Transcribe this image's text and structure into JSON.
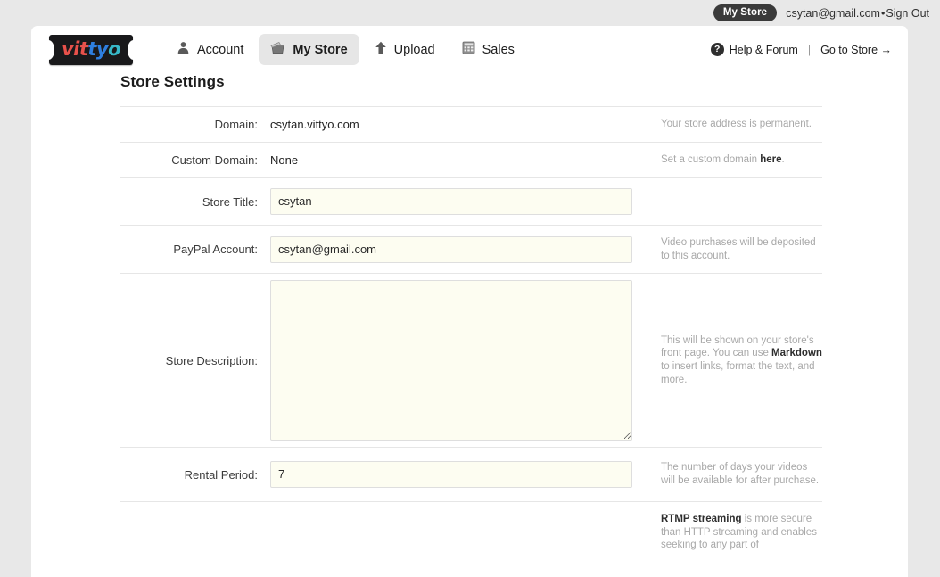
{
  "topbar": {
    "store_badge": "My Store",
    "account_email": "csytan@gmail.com",
    "separator": "•",
    "sign_out": "Sign Out"
  },
  "header": {
    "logo": {
      "part1": "vit",
      "part2": "ty",
      "part3": "o",
      "color1": "#e8514b",
      "color2": "#2e7fe0",
      "color3": "#37b9c9"
    },
    "nav": [
      {
        "label": "Account",
        "icon": "person-icon",
        "active": false
      },
      {
        "label": "My Store",
        "icon": "basket-icon",
        "active": true
      },
      {
        "label": "Upload",
        "icon": "up-arrow-icon",
        "active": false
      },
      {
        "label": "Sales",
        "icon": "calculator-icon",
        "active": false
      }
    ],
    "help_label": "Help & Forum",
    "help_icon": "question-mark-icon",
    "divider": "|",
    "go_to_store": "Go to Store →"
  },
  "main": {
    "page_title": "Store Settings",
    "rows": {
      "domain": {
        "label": "Domain:",
        "value": "csytan.vittyo.com",
        "help": "Your store address is permanent."
      },
      "custom_domain": {
        "label": "Custom Domain:",
        "value": "None",
        "help_pre": "Set a custom domain ",
        "help_link": "here",
        "help_post": "."
      },
      "store_title": {
        "label": "Store Title:",
        "value": "csytan",
        "placeholder": ""
      },
      "paypal": {
        "label": "PayPal Account:",
        "value": "csytan@gmail.com",
        "placeholder": "",
        "help": "Video purchases will be deposited to this account."
      },
      "store_description": {
        "label": "Store Description:",
        "value": "",
        "placeholder": "",
        "help_pre": "This will be shown on your store's front page. You can use ",
        "help_link": "Markdown",
        "help_post": " to insert links, format the text, and more."
      },
      "rental_period": {
        "label": "Rental Period:",
        "value": "7",
        "placeholder": "",
        "help": "The number of days your videos will be available for after purchase."
      },
      "rtmp": {
        "help_link": "RTMP streaming",
        "help_post": " is more secure than HTTP streaming and enables seeking to any part of"
      }
    }
  }
}
